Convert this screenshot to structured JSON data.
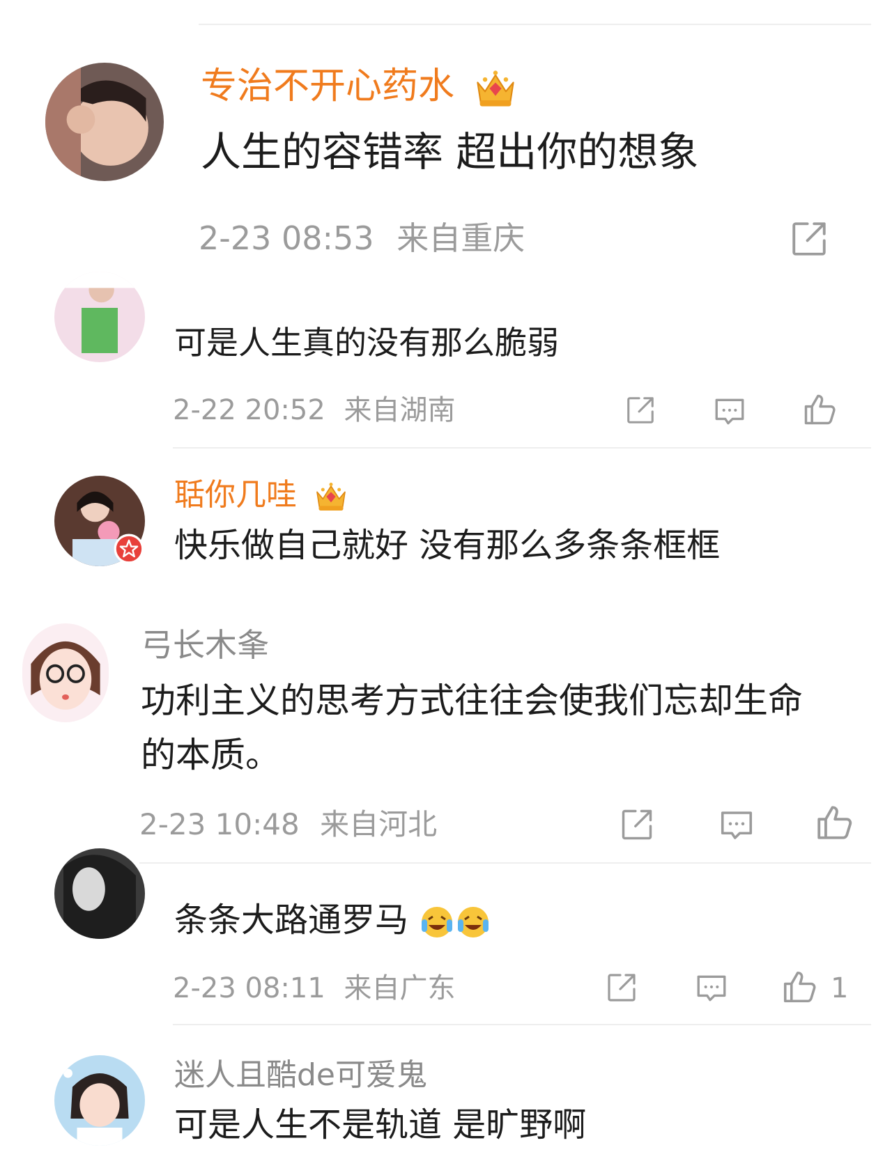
{
  "colors": {
    "vip_name": "#f07b1d",
    "normal_name": "#8a8a8a",
    "body_text": "#1c1c1c",
    "meta_text": "#9b9b9b",
    "icon": "#9b9b9b",
    "divider": "#eeeeee"
  },
  "comments": [
    {
      "name": "专治不开心药水",
      "badge": "crown-badge-level-3",
      "text": "人生的容错率 超出你的想象",
      "time": "2-23 08:53",
      "location": "来自重庆",
      "actions": [
        "share-icon"
      ]
    },
    {
      "name": "",
      "text": "可是人生真的没有那么脆弱",
      "time": "2-22 20:52",
      "location": "来自湖南",
      "actions": [
        "share-icon",
        "comment-icon",
        "like-icon"
      ]
    },
    {
      "name": "聒你几哇",
      "badge": "crown-badge-level-2",
      "verified": "red-star-badge",
      "text": "快乐做自己就好 没有那么多条条框框"
    },
    {
      "name": "弓长木夆",
      "text_line1": "功利主义的思考方式往往会使我们忘却生命",
      "text_line2": "的本质。",
      "time": "2-23 10:48",
      "location": "来自河北",
      "actions": [
        "share-icon",
        "comment-icon",
        "like-icon"
      ]
    },
    {
      "name": "",
      "text": "条条大路通罗马",
      "emoji": "crying-laughing-emoji",
      "time": "2-23 08:11",
      "location": "来自广东",
      "like_count": "1",
      "actions": [
        "share-icon",
        "comment-icon",
        "like-icon"
      ]
    },
    {
      "name": "迷人且酷de可爱鬼",
      "text": "可是人生不是轨道 是旷野啊"
    }
  ]
}
